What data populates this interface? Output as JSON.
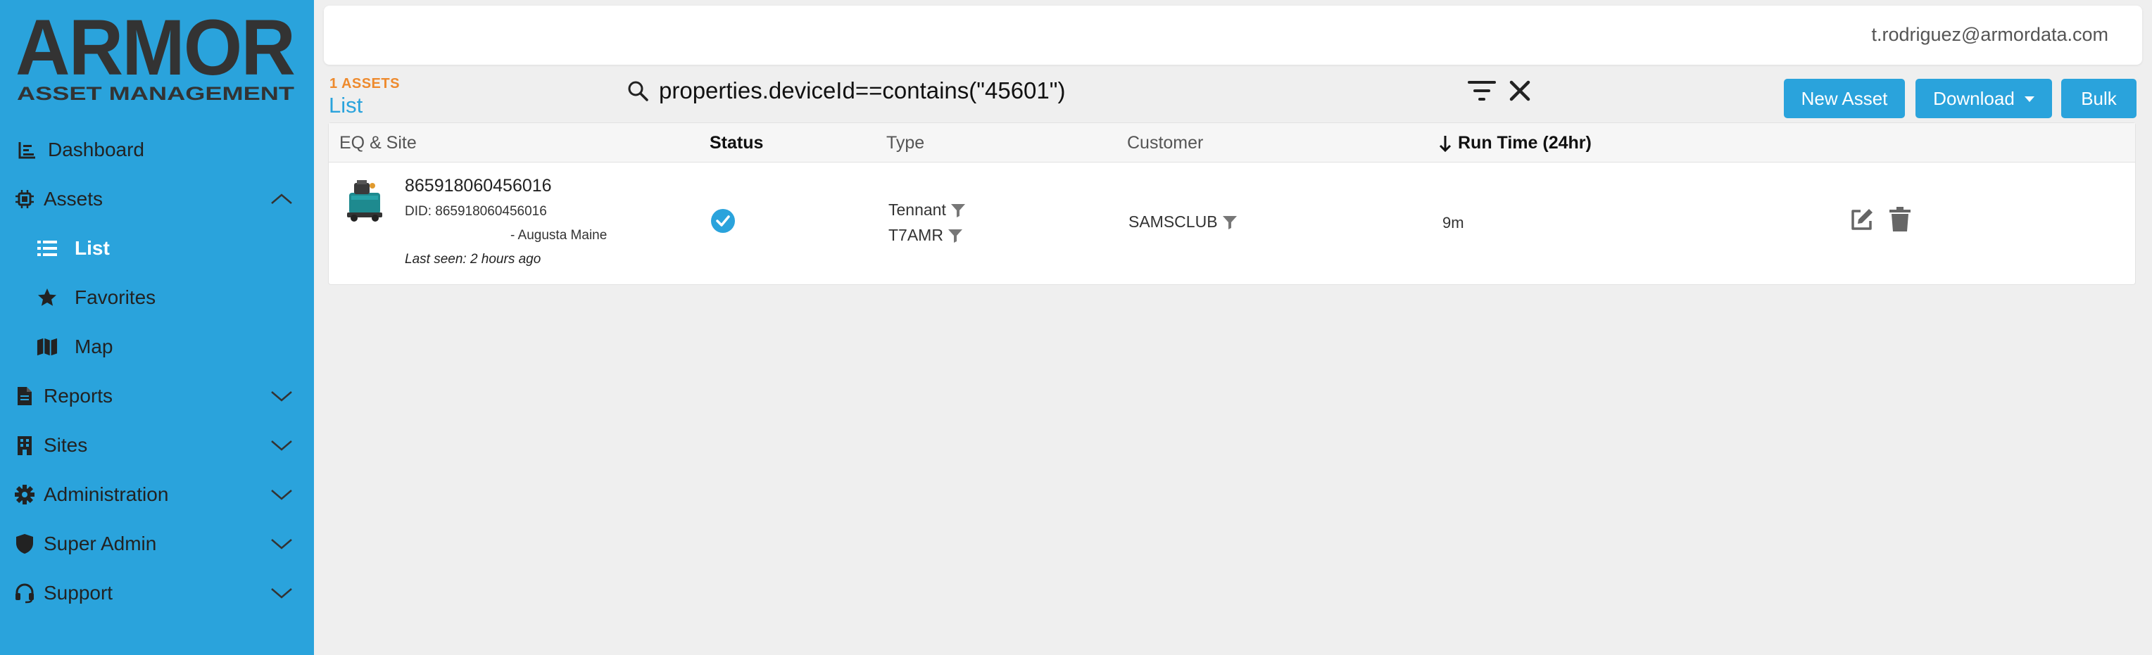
{
  "brand": {
    "logo_text": "ARMOR",
    "logo_subtitle": "ASSET MANAGEMENT"
  },
  "sidebar": {
    "items": [
      {
        "label": "Dashboard",
        "icon": "chart-line-icon"
      },
      {
        "label": "Assets",
        "icon": "chip-icon",
        "expanded": true
      },
      {
        "label": "List",
        "icon": "list-icon",
        "active": true
      },
      {
        "label": "Favorites",
        "icon": "star-icon"
      },
      {
        "label": "Map",
        "icon": "map-icon"
      },
      {
        "label": "Reports",
        "icon": "file-icon"
      },
      {
        "label": "Sites",
        "icon": "building-icon"
      },
      {
        "label": "Administration",
        "icon": "gear-icon"
      },
      {
        "label": "Super Admin",
        "icon": "shield-icon"
      },
      {
        "label": "Support",
        "icon": "headset-icon"
      }
    ]
  },
  "header": {
    "user_email": "t.rodriguez@armordata.com"
  },
  "page": {
    "assets_count": "1 ASSETS",
    "title": "List",
    "search_query": "properties.deviceId==contains(\"45601\")"
  },
  "toolbar": {
    "new_asset_label": "New Asset",
    "download_label": "Download",
    "bulk_label": "Bulk"
  },
  "table": {
    "columns": {
      "eq_site": "EQ & Site",
      "status": "Status",
      "type": "Type",
      "customer": "Customer",
      "run_time": "Run Time (24hr)"
    },
    "rows": [
      {
        "name": "865918060456016",
        "did": "DID: 865918060456016",
        "site": "- Augusta Maine",
        "last_seen": "Last seen: 2 hours ago",
        "status": "ok",
        "make": "Tennant",
        "model": "T7AMR",
        "customer": "SAMSCLUB",
        "run_time": "9m"
      }
    ]
  },
  "colors": {
    "sidebar": "#2aa3dc",
    "accent": "#2aa3dc",
    "count": "#ee8a2d"
  }
}
